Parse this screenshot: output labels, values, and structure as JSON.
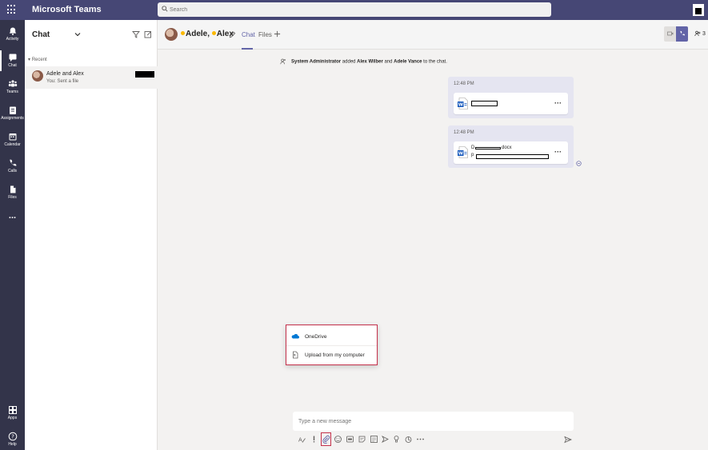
{
  "titlebar": {
    "app_title": "Microsoft Teams",
    "search_placeholder": "Search"
  },
  "appbar": {
    "items": [
      {
        "label": "Activity",
        "icon": "bell-icon"
      },
      {
        "label": "Chat",
        "icon": "chat-icon",
        "active": true
      },
      {
        "label": "Teams",
        "icon": "teams-icon"
      },
      {
        "label": "Assignments",
        "icon": "assignments-icon"
      },
      {
        "label": "Calendar",
        "icon": "calendar-icon"
      },
      {
        "label": "Calls",
        "icon": "phone-icon"
      },
      {
        "label": "Files",
        "icon": "files-icon"
      },
      {
        "label": "...",
        "icon": "more-icon"
      }
    ],
    "bottom_items": [
      {
        "label": "Apps",
        "icon": "apps-icon"
      },
      {
        "label": "Help",
        "icon": "help-icon"
      }
    ]
  },
  "chatlist": {
    "title": "Chat",
    "recent_label": "Recent",
    "chats": [
      {
        "name": "Adele and Alex",
        "preview": "You: Sent a file"
      }
    ]
  },
  "conversation": {
    "participants": [
      "Adele",
      "Alex"
    ],
    "name_display": "Adele, Alex",
    "tabs": [
      {
        "label": "Chat",
        "active": true
      },
      {
        "label": "Files",
        "active": false
      }
    ],
    "participant_count": "3",
    "system_message": {
      "actor": "System Administrator",
      "text1": " added ",
      "person1": "Alex Wilber",
      "text2": " and ",
      "person2": "Adele Vance",
      "text3": " to the chat."
    },
    "messages": [
      {
        "time": "12:48 PM",
        "file_name": ""
      },
      {
        "time": "12:48 PM",
        "file_name_prefix": "D",
        "file_name_suffix": "docx",
        "file_sub_prefix": "p"
      }
    ]
  },
  "attach_menu": {
    "items": [
      {
        "label": "OneDrive",
        "icon": "onedrive-icon"
      },
      {
        "label": "Upload from my computer",
        "icon": "upload-file-icon"
      }
    ]
  },
  "compose": {
    "placeholder": "Type a new message"
  },
  "colors": {
    "brand": "#464775",
    "accent": "#6264a7",
    "highlight_border": "#c4314b"
  }
}
